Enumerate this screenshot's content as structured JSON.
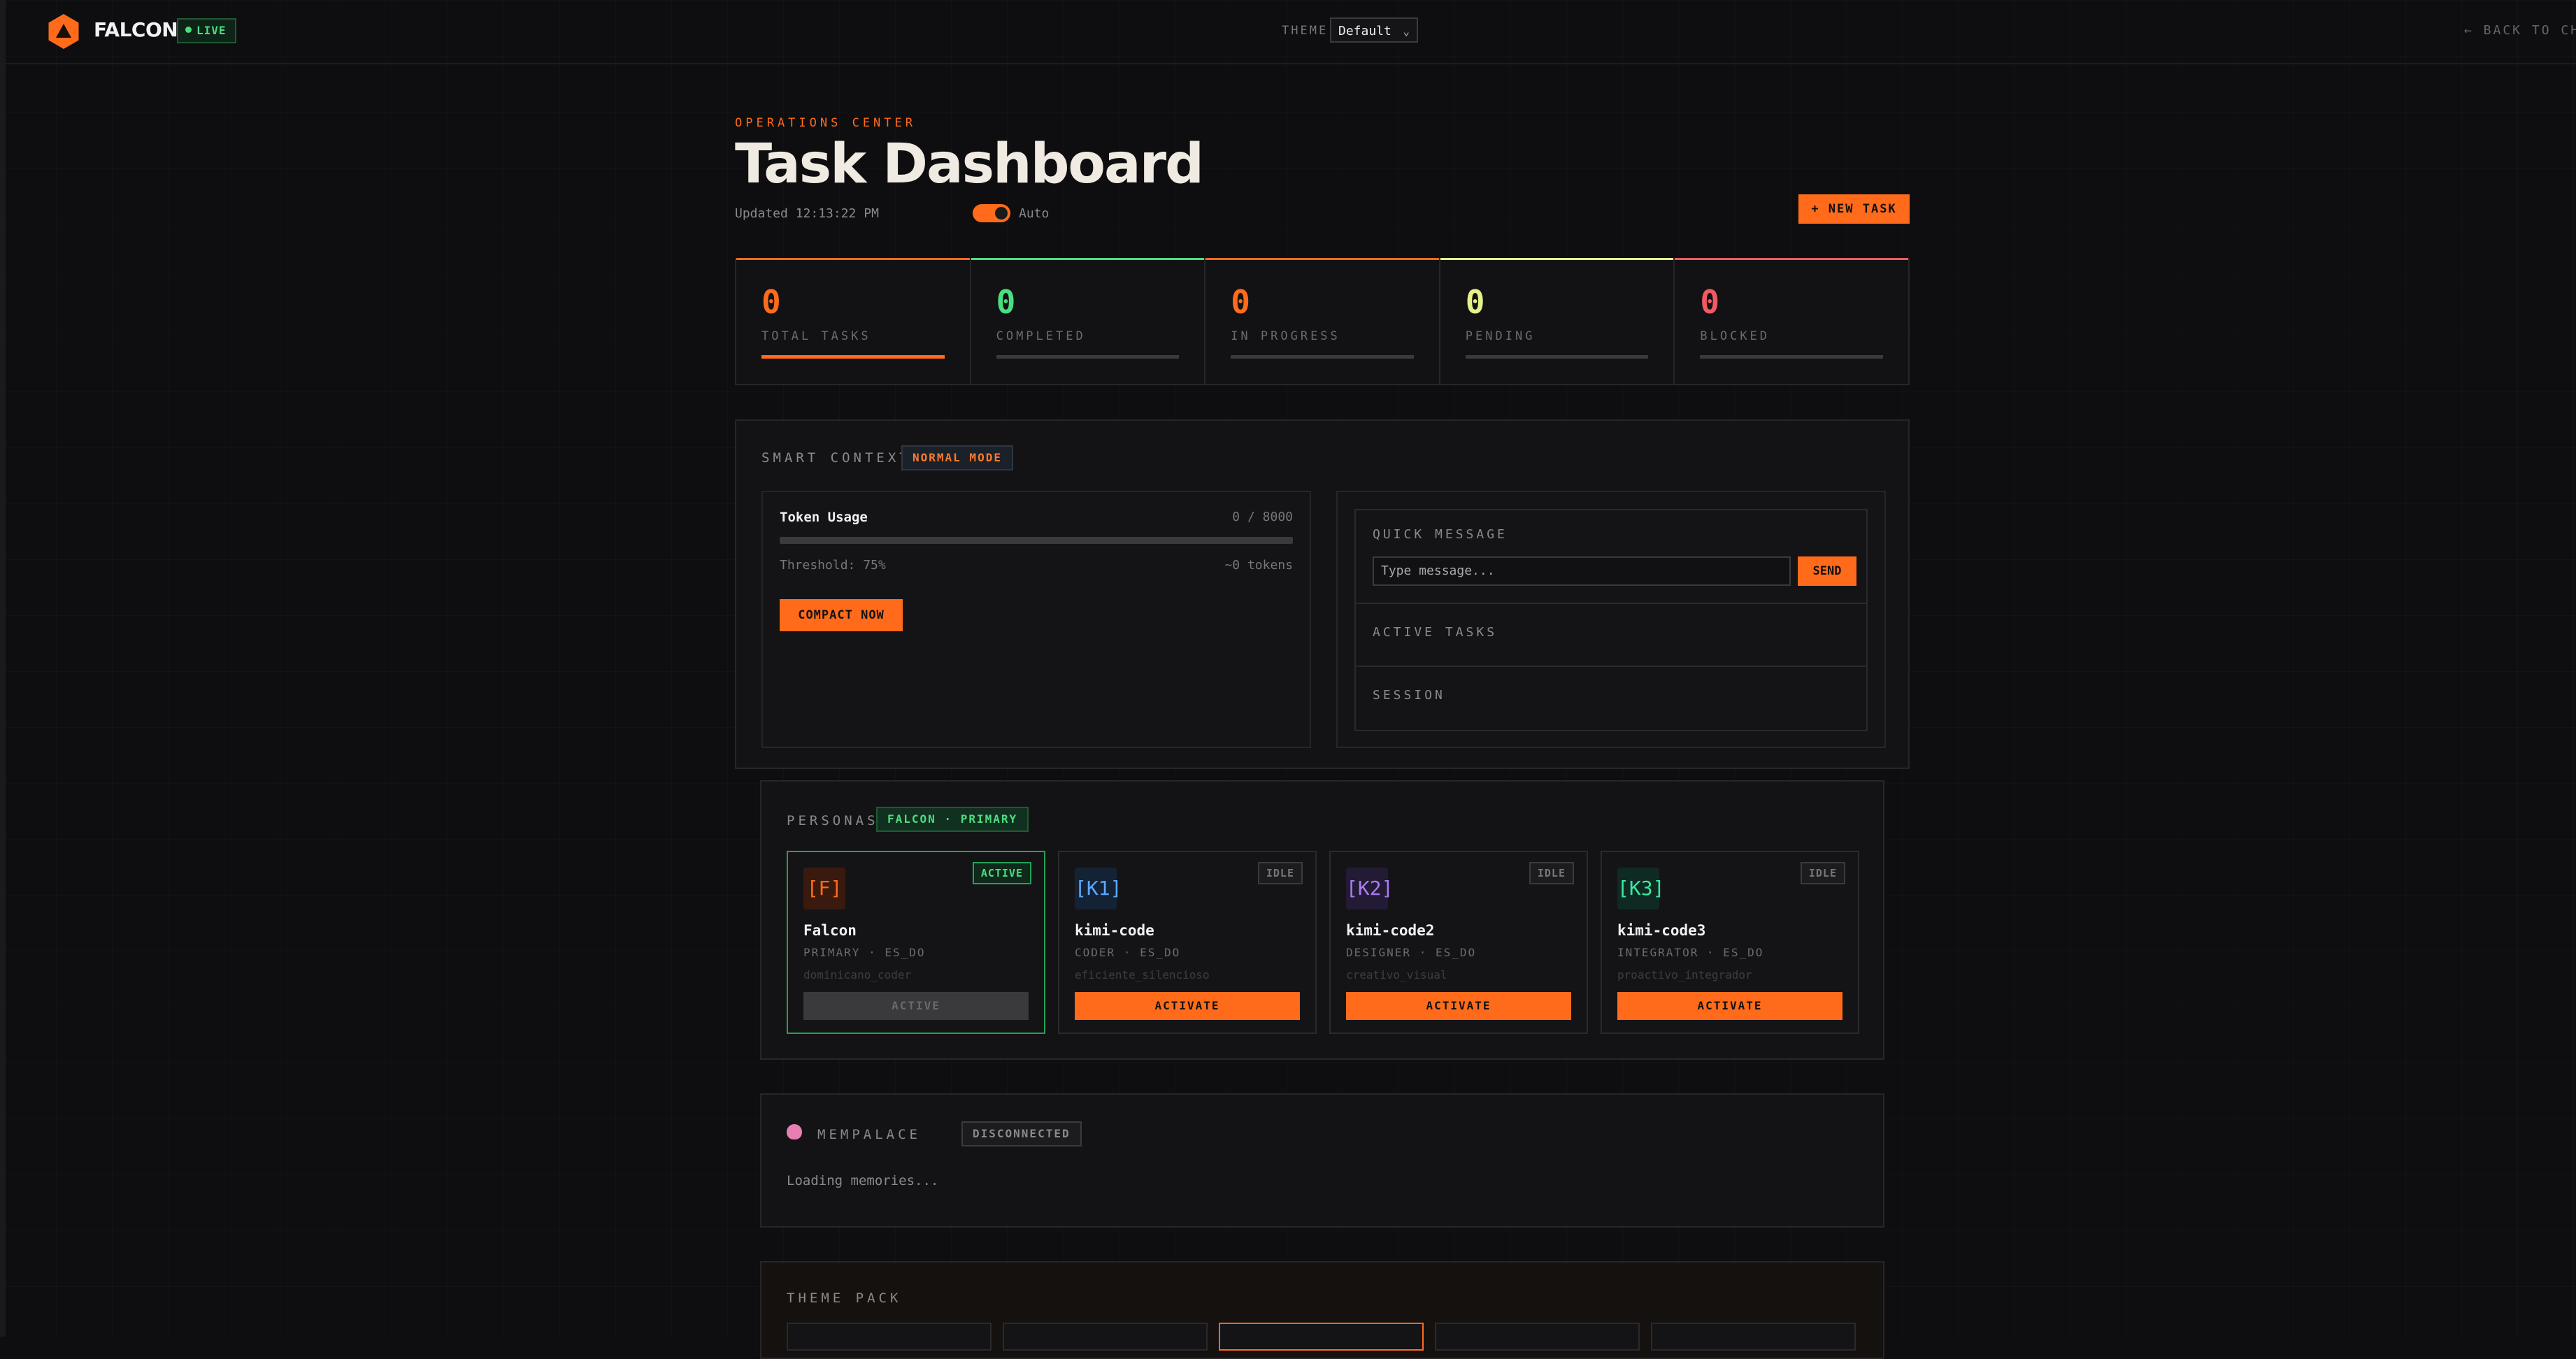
{
  "header": {
    "brand": "FALCON",
    "live_badge": "LIVE",
    "theme_label": "THEME",
    "theme_value": "Default",
    "back_link": "← BACK TO CH"
  },
  "page": {
    "eyebrow": "OPERATIONS CENTER",
    "title": "Task Dashboard",
    "updated": "Updated 12:13:22 PM",
    "auto_label": "Auto",
    "auto_refresh_on": true,
    "new_task_label": "+ NEW TASK"
  },
  "stats": [
    {
      "value": "0",
      "label": "TOTAL TASKS",
      "color": "#ff6b1a"
    },
    {
      "value": "0",
      "label": "COMPLETED",
      "color": "#4ade80"
    },
    {
      "value": "0",
      "label": "IN PROGRESS",
      "color": "#ff6b1a"
    },
    {
      "value": "0",
      "label": "PENDING",
      "color": "#e6f089"
    },
    {
      "value": "0",
      "label": "BLOCKED",
      "color": "#f05a63"
    }
  ],
  "smart_context": {
    "title": "SMART CONTEXT",
    "mode_badge": "NORMAL MODE",
    "token_title": "Token Usage",
    "token_count": "0 / 8000",
    "threshold": "Threshold: 75%",
    "estimate": "~0 tokens",
    "compact_label": "COMPACT NOW",
    "quick_message_title": "QUICK MESSAGE",
    "message_placeholder": "Type message...",
    "send_label": "SEND",
    "active_tasks_title": "ACTIVE TASKS",
    "session_title": "SESSION"
  },
  "personas_section": {
    "title": "PERSONAS",
    "badge": "FALCON · PRIMARY",
    "items": [
      {
        "tag": "[F]",
        "name": "Falcon",
        "role": "PRIMARY · ES_DO",
        "style": "dominicano_coder",
        "state": "ACTIVE",
        "button": "ACTIVE",
        "tag_color": "#ff6b1a",
        "tag_bg": "#3a1a0e"
      },
      {
        "tag": "[K1]",
        "name": "kimi-code",
        "role": "CODER · ES_DO",
        "style": "eficiente_silencioso",
        "state": "IDLE",
        "button": "ACTIVATE",
        "tag_color": "#5aa9ff",
        "tag_bg": "#142236"
      },
      {
        "tag": "[K2]",
        "name": "kimi-code2",
        "role": "DESIGNER · ES_DO",
        "style": "creativo_visual",
        "state": "IDLE",
        "button": "ACTIVATE",
        "tag_color": "#a97cf0",
        "tag_bg": "#231a36"
      },
      {
        "tag": "[K3]",
        "name": "kimi-code3",
        "role": "INTEGRATOR · ES_DO",
        "style": "proactivo_integrador",
        "state": "IDLE",
        "button": "ACTIVATE",
        "tag_color": "#3ee6a0",
        "tag_bg": "#0f2a22"
      }
    ]
  },
  "mempalace": {
    "icon": "brain-icon",
    "title": "MEMPALACE",
    "status": "DISCONNECTED",
    "loading": "Loading memories..."
  },
  "theme_pack": {
    "title": "THEME PACK"
  }
}
